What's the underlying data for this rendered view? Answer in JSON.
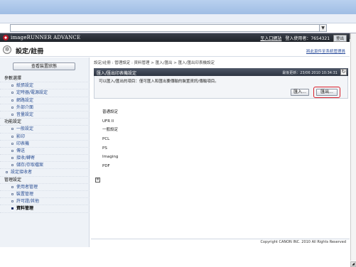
{
  "brand": {
    "name": "imageRUNNER ADVANCE"
  },
  "header": {
    "mode_link": "至入口網站",
    "user_label": "登入使用者：7654321",
    "logout_label": "登出",
    "window_button": "□"
  },
  "page": {
    "title": "設定/註冊",
    "email_link": "將此頁件至系統管理員"
  },
  "sidebar": {
    "view_status_button": "查看裝置狀態",
    "items": [
      {
        "label": "參數選擇",
        "kind": "section"
      },
      {
        "label": "紙張設定",
        "kind": "sub"
      },
      {
        "label": "定時器/電源設定",
        "kind": "sub"
      },
      {
        "label": "網路設定",
        "kind": "sub"
      },
      {
        "label": "外部介面",
        "kind": "sub"
      },
      {
        "label": "音量設定",
        "kind": "sub"
      },
      {
        "label": "功能設定",
        "kind": "section"
      },
      {
        "label": "一般設定",
        "kind": "sub"
      },
      {
        "label": "影印",
        "kind": "sub"
      },
      {
        "label": "印表機",
        "kind": "sub"
      },
      {
        "label": "傳送",
        "kind": "sub"
      },
      {
        "label": "接收/轉寄",
        "kind": "sub"
      },
      {
        "label": "儲存/存取檔案",
        "kind": "sub"
      },
      {
        "label": "設定接收者",
        "kind": "sectionsub"
      },
      {
        "label": "管理設定",
        "kind": "section"
      },
      {
        "label": "使用者管理",
        "kind": "sub"
      },
      {
        "label": "裝置管理",
        "kind": "sub"
      },
      {
        "label": "許可證/其他",
        "kind": "sub"
      },
      {
        "label": "資料管理",
        "kind": "sub",
        "active": true
      }
    ]
  },
  "content": {
    "breadcrumb": "設定/註冊 : 管理設定 : 資料管理 > 匯入/匯出 > 匯入/匯出印表機設定",
    "panel_title": "匯入/匯出印表機設定",
    "last_updated": "最後更新：23/06 2010 10:34:31",
    "refresh_icon": "↻",
    "description": "可以匯入/匯出的項目：僅可匯入和匯出要傳輸的裝置資訊/傳輸項目。",
    "import_button": "匯入...",
    "export_button": "匯出...",
    "items": [
      "普通設定",
      "UFR II",
      "一般設定",
      "PCL",
      "PS",
      "Imaging",
      "PDF"
    ],
    "expand_icon": "≡"
  },
  "footer": {
    "copyright": "Copyright CANON INC. 2010 All Rights Reserved"
  },
  "browser": {
    "address_dropdown": "▼"
  },
  "colors": {
    "highlight": "#d81e2a",
    "header_dark": "#1f2329",
    "link": "#2b4f94"
  }
}
